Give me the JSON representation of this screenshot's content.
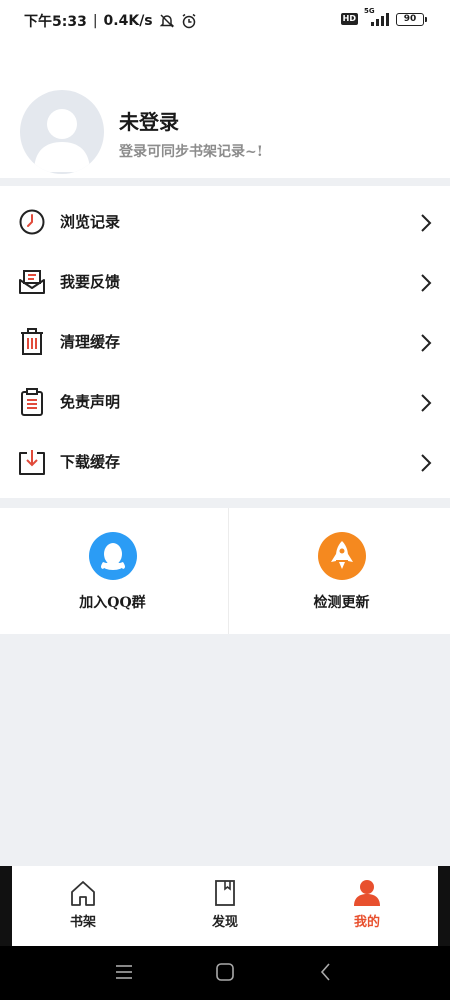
{
  "status_bar": {
    "time": "下午5:33",
    "net_speed": "0.4K/s",
    "hd": "HD",
    "network": "5G",
    "battery": "90",
    "icons": [
      "mute-icon",
      "alarm-icon",
      "signal-icon",
      "battery-icon"
    ]
  },
  "profile": {
    "name": "未登录",
    "hint": "登录可同步书架记录~!"
  },
  "menu": {
    "items": [
      {
        "label": "浏览记录",
        "icon": "clock-icon"
      },
      {
        "label": "我要反馈",
        "icon": "feedback-envelope-icon"
      },
      {
        "label": "清理缓存",
        "icon": "trash-icon"
      },
      {
        "label": "免责声明",
        "icon": "clipboard-icon"
      },
      {
        "label": "下载缓存",
        "icon": "download-tray-icon"
      }
    ]
  },
  "tiles": [
    {
      "label": "加入QQ群",
      "icon": "qq-penguin-icon",
      "color": "#2b9cf5"
    },
    {
      "label": "检测更新",
      "icon": "rocket-icon",
      "color": "#f5891f"
    }
  ],
  "tabs": [
    {
      "label": "书架",
      "icon": "house-icon",
      "active": false
    },
    {
      "label": "发现",
      "icon": "book-icon",
      "active": false
    },
    {
      "label": "我的",
      "icon": "person-icon",
      "active": true
    }
  ],
  "colors": {
    "accent": "#e8502e",
    "icon_red": "#e14b3b",
    "qq_blue": "#2b9cf5",
    "update_orange": "#f5891f"
  }
}
